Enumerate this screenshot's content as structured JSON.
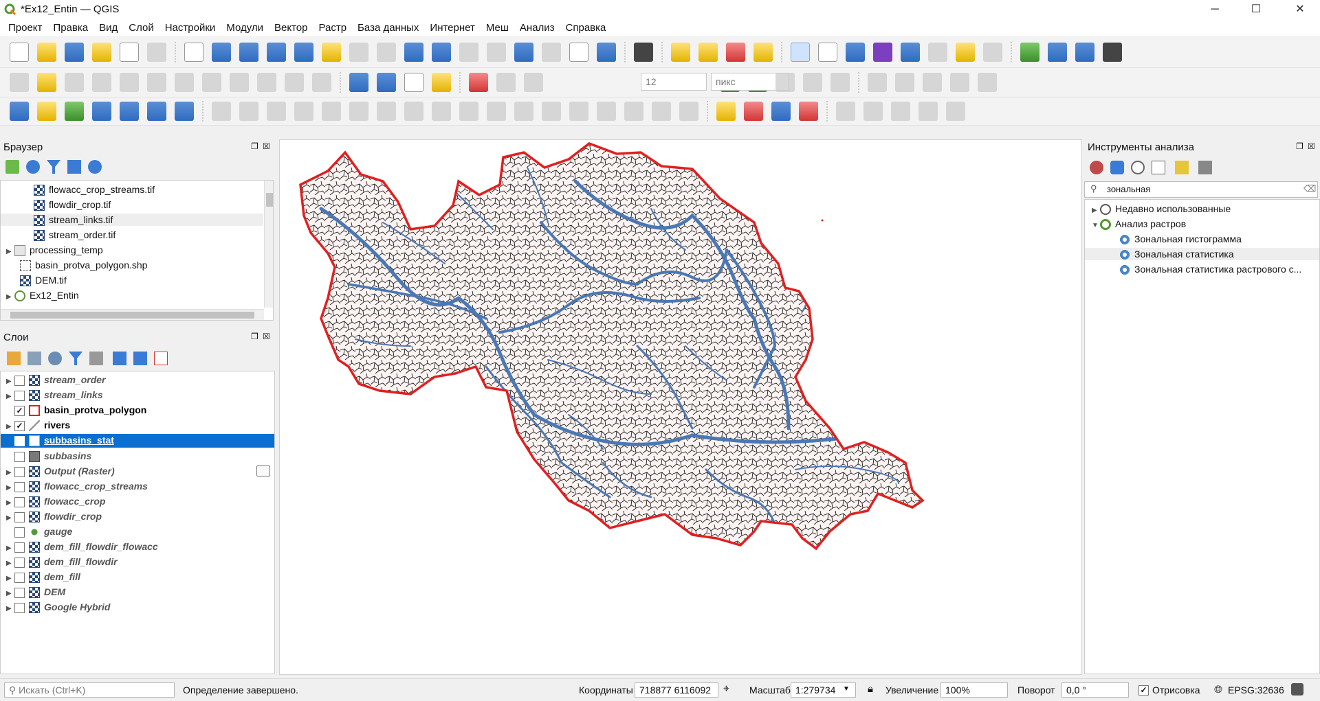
{
  "window": {
    "title": "*Ex12_Entin — QGIS",
    "controls": {
      "minimize": "─",
      "maximize": "☐",
      "close": "✕"
    }
  },
  "menu": [
    "Проект",
    "Правка",
    "Вид",
    "Слой",
    "Настройки",
    "Модули",
    "Вектор",
    "Растр",
    "База данных",
    "Интернет",
    "Меш",
    "Анализ",
    "Справка"
  ],
  "digitizing": {
    "snap_value": "12",
    "snap_units": "пикс"
  },
  "browser": {
    "title": "Браузер",
    "items": [
      {
        "label": "flowacc_crop_streams.tif",
        "type": "raster"
      },
      {
        "label": "flowdir_crop.tif",
        "type": "raster"
      },
      {
        "label": "stream_links.tif",
        "type": "raster"
      },
      {
        "label": "stream_order.tif",
        "type": "raster"
      },
      {
        "label": "processing_temp",
        "type": "folder"
      },
      {
        "label": "basin_protva_polygon.shp",
        "type": "vector"
      },
      {
        "label": "DEM.tif",
        "type": "raster"
      },
      {
        "label": "Ex12_Entin",
        "type": "project"
      }
    ]
  },
  "layers": {
    "title": "Слои",
    "items": [
      {
        "name": "stream_order",
        "checked": false,
        "icon": "raster"
      },
      {
        "name": "stream_links",
        "checked": false,
        "icon": "raster"
      },
      {
        "name": "basin_protva_polygon",
        "checked": true,
        "icon": "polygon-red"
      },
      {
        "name": "rivers",
        "checked": true,
        "icon": "line"
      },
      {
        "name": "subbasins_stat",
        "checked": true,
        "icon": "polygon-white",
        "selected": true
      },
      {
        "name": "subbasins",
        "checked": false,
        "icon": "polygon-gray"
      },
      {
        "name": "Output (Raster)",
        "checked": false,
        "icon": "raster"
      },
      {
        "name": "flowacc_crop_streams",
        "checked": false,
        "icon": "raster"
      },
      {
        "name": "flowacc_crop",
        "checked": false,
        "icon": "raster"
      },
      {
        "name": "flowdir_crop",
        "checked": false,
        "icon": "raster"
      },
      {
        "name": "gauge",
        "checked": false,
        "icon": "point"
      },
      {
        "name": "dem_fill_flowdir_flowacc",
        "checked": false,
        "icon": "raster"
      },
      {
        "name": "dem_fill_flowdir",
        "checked": false,
        "icon": "raster"
      },
      {
        "name": "dem_fill",
        "checked": false,
        "icon": "raster"
      },
      {
        "name": "DEM",
        "checked": false,
        "icon": "raster"
      },
      {
        "name": "Google Hybrid",
        "checked": false,
        "icon": "raster"
      }
    ]
  },
  "processing": {
    "title": "Инструменты анализа",
    "search_value": "зональная",
    "tree": [
      {
        "label": "Недавно использованные",
        "level": 0,
        "icon": "clock"
      },
      {
        "label": "Анализ растров",
        "level": 0,
        "icon": "qgis"
      },
      {
        "label": "Зональная гистограмма",
        "level": 1,
        "icon": "gear"
      },
      {
        "label": "Зональная статистика",
        "level": 1,
        "icon": "gear",
        "selected": true
      },
      {
        "label": "Зональная статистика растрового с...",
        "level": 1,
        "icon": "gear"
      }
    ]
  },
  "statusbar": {
    "search_placeholder": "Искать (Ctrl+K)",
    "message": "Определение завершено.",
    "coord_label": "Координаты",
    "coord_value": "718877  6116092",
    "scale_label": "Масштаб",
    "scale_value": "1:279734",
    "magnifier_label": "Увеличение",
    "magnifier_value": "100%",
    "rotation_label": "Поворот",
    "rotation_value": "0,0 °",
    "render_label": "Отрисовка",
    "crs": "EPSG:32636"
  },
  "colors": {
    "basin_outline": "#e02020",
    "basin_fill": "#fbf3f1",
    "rivers": "#4a78b5",
    "subbasin_lines": "#1a1a1a",
    "selection": "#0a6fd0"
  }
}
